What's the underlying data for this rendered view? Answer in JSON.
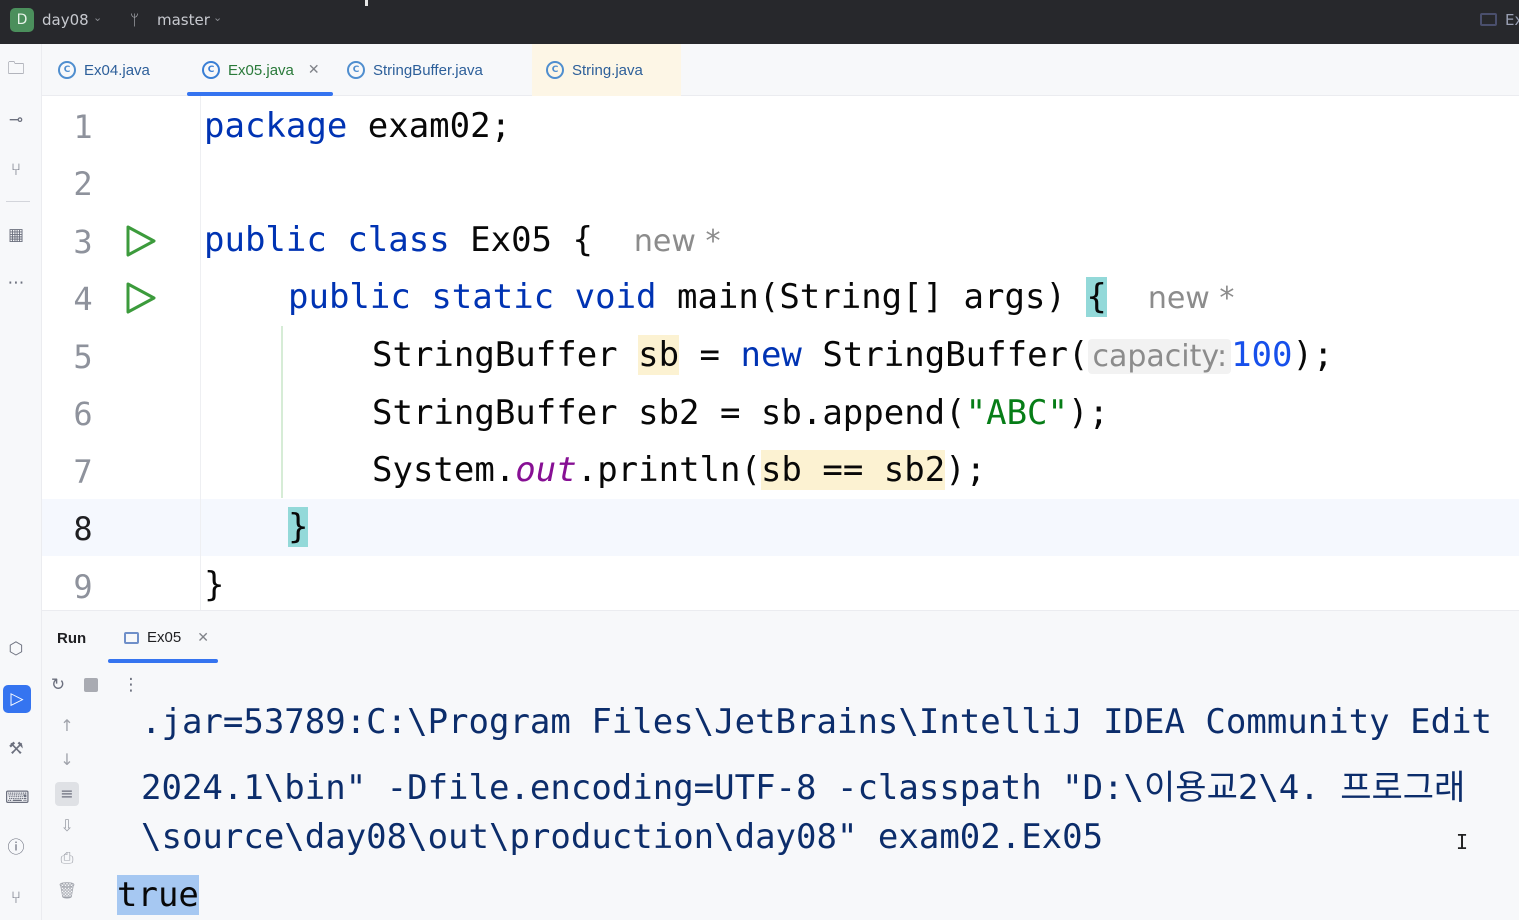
{
  "titlebar": {
    "project_badge": "D",
    "project_name": "day08",
    "branch_name": "master",
    "run_config_label": "Ex"
  },
  "tabs": [
    {
      "label": "Ex04.java",
      "icon": "class-icon"
    },
    {
      "label": "Ex05.java",
      "icon": "class-icon",
      "active": true
    },
    {
      "label": "StringBuffer.java",
      "icon": "class-icon"
    },
    {
      "label": "String.java",
      "icon": "class-icon"
    }
  ],
  "editor": {
    "line_numbers": [
      "1",
      "2",
      "3",
      "4",
      "5",
      "6",
      "7",
      "8",
      "9"
    ],
    "current_line": "8",
    "lines": {
      "l1_kw": "package",
      "l1_rest": " exam02;",
      "l3_kw1": "public",
      "l3_kw2": "class",
      "l3_rest": " Ex05 { ",
      "l3_hint": "new *",
      "l4_kw1": "public",
      "l4_kw2": "static",
      "l4_kw3": "void",
      "l4_rest": " main(String[] args) ",
      "l4_brace": "{",
      "l4_hint": "new *",
      "l5_type": "StringBuffer ",
      "l5_var": "sb",
      "l5_eq": " = ",
      "l5_new": "new",
      "l5_call": " StringBuffer(",
      "l5_hint": "capacity:",
      "l5_num": "100",
      "l5_end": ");",
      "l6_pre": "StringBuffer sb2 = sb.append(",
      "l6_str": "\"ABC\"",
      "l6_end": ");",
      "l7_pre": "System.",
      "l7_field": "out",
      "l7_call": ".println(",
      "l7_expr": "sb == sb2",
      "l7_end": ");",
      "l8_brace": "}",
      "l9_brace": "}"
    }
  },
  "run_panel": {
    "title": "Run",
    "tab_label": "Ex05",
    "console_lines": [
      ".jar=53789:C:\\Program Files\\JetBrains\\IntelliJ IDEA Community Edit",
      "2024.1\\bin\" -Dfile.encoding=UTF-8 -classpath \"D:\\이용교2\\4. 프로그래",
      "\\source\\day08\\out\\production\\day08\" exam02.Ex05"
    ],
    "output": "true"
  },
  "colors": {
    "keyword": "#0033b3",
    "string": "#067d17",
    "field": "#871094",
    "number": "#1750eb",
    "accent": "#3574f0",
    "brace_match": "#93d9d9",
    "usage_highlight": "#fcf2d2"
  }
}
